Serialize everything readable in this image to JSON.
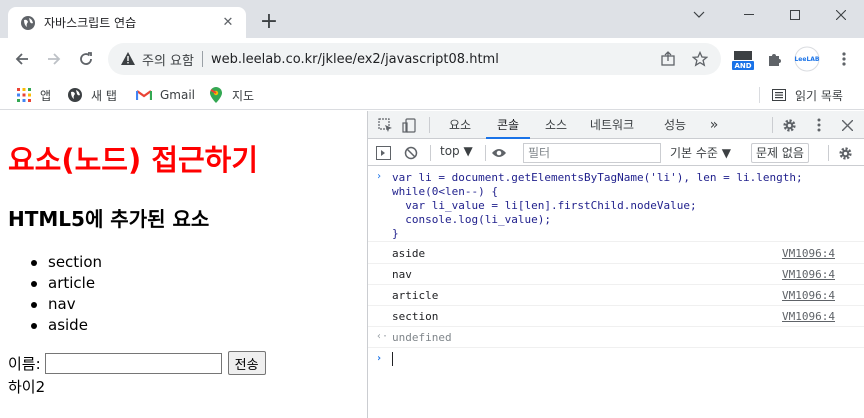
{
  "browser": {
    "tab_title": "자바스크립트 연습",
    "tab_close": "✕",
    "new_tab": "+",
    "window_controls": {
      "minimize": "—",
      "maximize": "☐",
      "close": "✕"
    },
    "security_label": "주의 요함",
    "url": "web.leelab.co.kr/jklee/ex2/javascript08.html",
    "extension_badge": "AND",
    "profile_label": "LeeLAB"
  },
  "bookmarks": {
    "items": [
      {
        "label": "앱",
        "icon": "apps-grid-icon"
      },
      {
        "label": "새 탭",
        "icon": "globe-icon"
      },
      {
        "label": "Gmail",
        "icon": "gmail-icon"
      },
      {
        "label": "지도",
        "icon": "maps-pin-icon"
      }
    ],
    "reading_list": "읽기 목록"
  },
  "page": {
    "heading": "요소(노드) 접근하기",
    "subheading": "HTML5에 추가된 요소",
    "list": [
      "section",
      "article",
      "nav",
      "aside"
    ],
    "name_label": "이름:",
    "name_value": "",
    "submit_label": "전송",
    "output": "하이2"
  },
  "devtools": {
    "tabs": [
      "요소",
      "콘솔",
      "소스",
      "네트워크",
      "성능"
    ],
    "active_tab": "콘솔",
    "more_tabs": "»",
    "context": "top ▼",
    "filter_placeholder": "필터",
    "levels": "기본 수준 ▼",
    "issues": "문제 없음",
    "command_lines": [
      "var li = document.getElementsByTagName('li'), len = li.length;",
      "while(0<len--) {",
      "  var li_value = li[len].firstChild.nodeValue;",
      "  console.log(li_value);",
      "}"
    ],
    "logs": [
      {
        "message": "aside",
        "source": "VM1096:4"
      },
      {
        "message": "nav",
        "source": "VM1096:4"
      },
      {
        "message": "article",
        "source": "VM1096:4"
      },
      {
        "message": "section",
        "source": "VM1096:4"
      }
    ],
    "result": "undefined",
    "prompt": "›",
    "return_arrow": "‹·"
  },
  "colors": {
    "heading": "#ff0000",
    "active_tab_underline": "#1a73e8",
    "tabstrip": "#dee1e6",
    "devtools_toolbar": "#f1f3f4"
  }
}
